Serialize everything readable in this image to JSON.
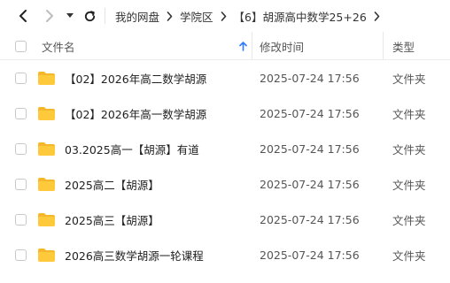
{
  "breadcrumb": [
    "我的网盘",
    "学院区",
    "【6】胡源高中数学25+26"
  ],
  "columns": {
    "name": "文件名",
    "modified": "修改时间",
    "type": "类型"
  },
  "files": [
    {
      "name": "【02】2026年高二数学胡源",
      "modified": "2025-07-24 17:56",
      "type": "文件夹"
    },
    {
      "name": "【02】2026年高一数学胡源",
      "modified": "2025-07-24 17:56",
      "type": "文件夹"
    },
    {
      "name": "03.2025高一【胡源】有道",
      "modified": "2025-07-24 17:56",
      "type": "文件夹"
    },
    {
      "name": "2025高二【胡源】",
      "modified": "2025-07-24 17:56",
      "type": "文件夹"
    },
    {
      "name": "2025高三【胡源】",
      "modified": "2025-07-24 17:56",
      "type": "文件夹"
    },
    {
      "name": "2026高三数学胡源一轮课程",
      "modified": "2025-07-24 17:56",
      "type": "文件夹"
    }
  ],
  "colors": {
    "folder": "#ffc93c",
    "folder_tab": "#f5b82a",
    "accent": "#2b7bff"
  }
}
